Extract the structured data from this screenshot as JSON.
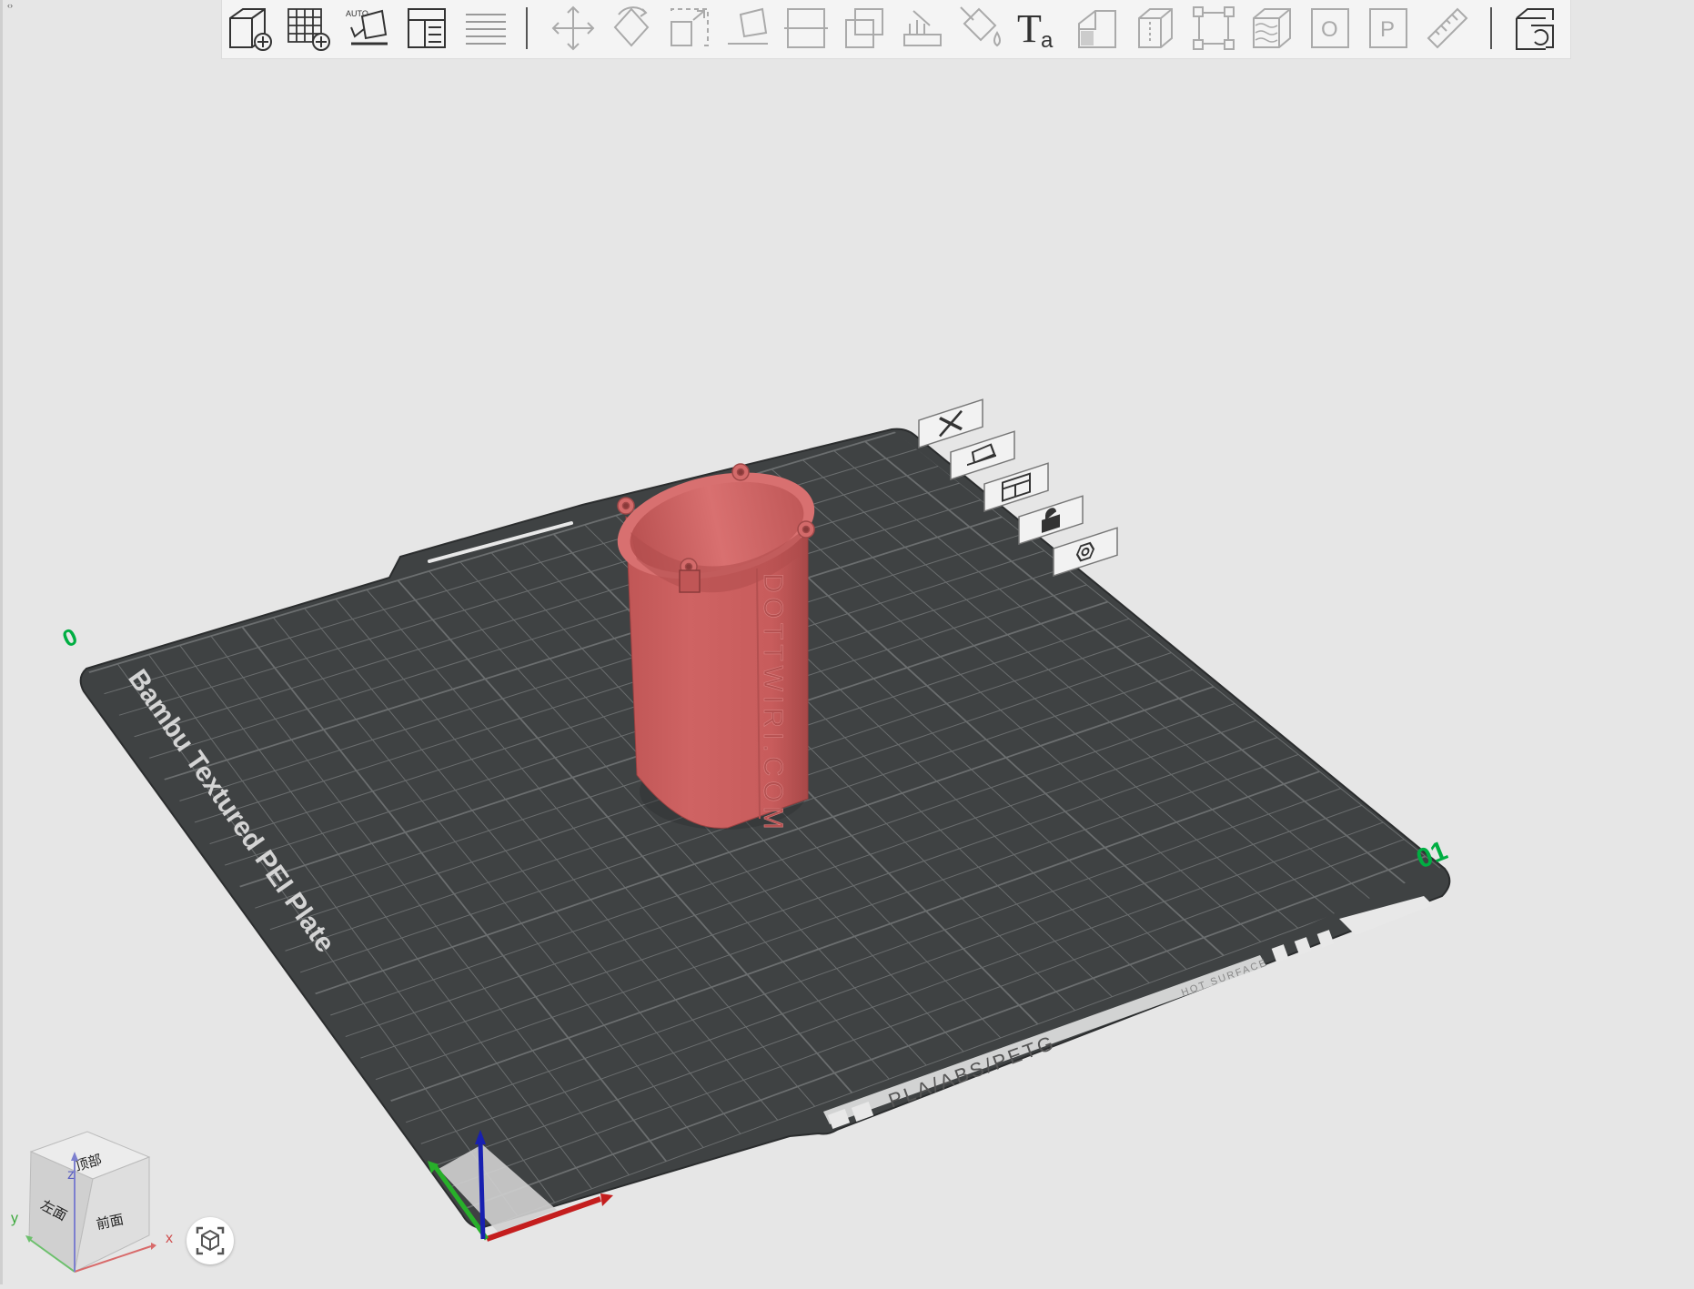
{
  "window": {
    "corner_toggle": "‹›"
  },
  "toolbar": {
    "groups": [
      [
        "add-object",
        "add-plate",
        "auto-orient",
        "arrange",
        "split-layers"
      ],
      [
        "move",
        "rotate",
        "scale",
        "lay-on-face",
        "cut",
        "boolean",
        "support-paint",
        "color-paint",
        "text",
        "assembly",
        "seam",
        "measure-box",
        "fuzzy-skin",
        "variable-layer",
        "brim-ear-o",
        "brim-ear-p",
        "ruler"
      ],
      [
        "assemble-view"
      ]
    ]
  },
  "plate": {
    "name_label": "Bambu Textured PEI Plate",
    "plate_number": "01",
    "origin_mark": "0",
    "material_label": "PLA/ABS/PETG",
    "surface_label": "HOT SURFACE",
    "side_buttons": [
      "close-plate",
      "auto-orient-plate",
      "arrange-plate",
      "lock-plate",
      "plate-settings"
    ]
  },
  "model": {
    "engraved_text": "DOTTWIRI.COM",
    "color": "#cf6363"
  },
  "view_cube": {
    "top": "顶部",
    "left": "左面",
    "front": "前面",
    "axis_x": "x",
    "axis_y": "y",
    "axis_z": "z"
  },
  "colors": {
    "background": "#e6e6e6",
    "plate": "#3f4243",
    "grid": "#6b6e6f",
    "accent_green": "#00ae42",
    "axis_x": "#c41e1e",
    "axis_y": "#28b02a",
    "axis_z": "#1820b0"
  }
}
